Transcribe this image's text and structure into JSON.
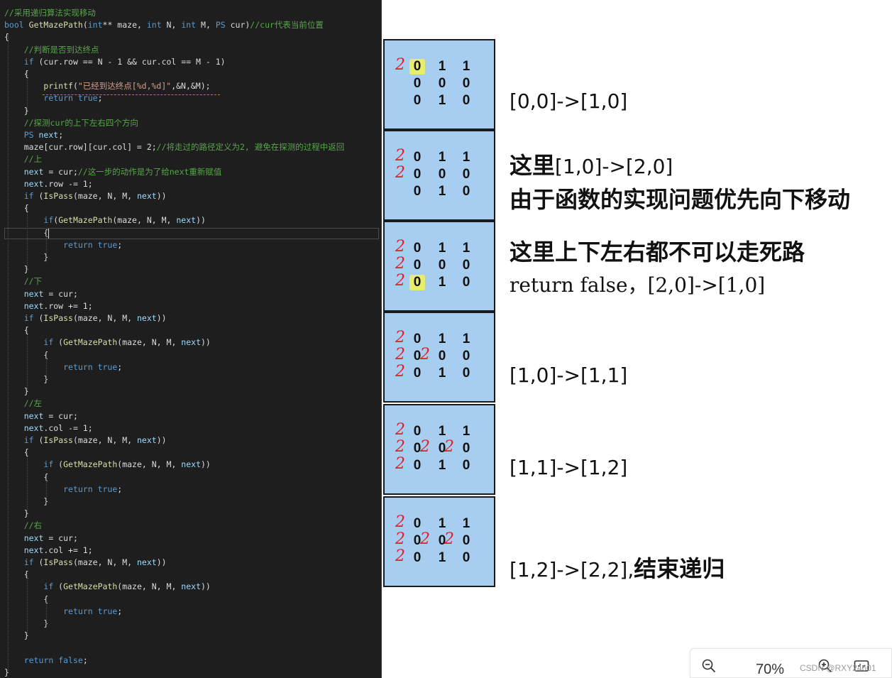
{
  "code": {
    "lines": [
      "//采用递归算法实现移动",
      "bool GetMazePath(int** maze, int N, int M, PS cur)//cur代表当前位置",
      "{",
      "    //判断是否到达终点",
      "    if (cur.row == N - 1 && cur.col == M - 1)",
      "    {",
      "        printf(\"已经到达终点[%d,%d]\",&N,&M);",
      "        return true;",
      "    }",
      "    //探测cur的上下左右四个方向",
      "    PS next;",
      "    maze[cur.row][cur.col] = 2;//将走过的路径定义为2, 避免在探测的过程中返回",
      "    //上",
      "    next = cur;//这一步的动作是为了给next重新赋值",
      "    next.row -= 1;",
      "    if (IsPass(maze, N, M, next))",
      "    {",
      "        if(GetMazePath(maze, N, M, next))",
      "        {",
      "            return true;",
      "        }",
      "    }",
      "    //下",
      "    next = cur;",
      "    next.row += 1;",
      "    if (IsPass(maze, N, M, next))",
      "    {",
      "        if (GetMazePath(maze, N, M, next))",
      "        {",
      "            return true;",
      "        }",
      "    }",
      "    //左",
      "    next = cur;",
      "    next.col -= 1;",
      "    if (IsPass(maze, N, M, next))",
      "    {",
      "        if (GetMazePath(maze, N, M, next))",
      "        {",
      "            return true;",
      "        }",
      "    }",
      "    //右",
      "    next = cur;",
      "    next.col += 1;",
      "    if (IsPass(maze, N, M, next))",
      "    {",
      "        if (GetMazePath(maze, N, M, next))",
      "        {",
      "            return true;",
      "        }",
      "    }",
      "",
      "    return false;",
      "}"
    ]
  },
  "mazes": [
    {
      "grid": [
        [
          "0",
          "1",
          "1"
        ],
        [
          "0",
          "0",
          "0"
        ],
        [
          "0",
          "1",
          "0"
        ]
      ],
      "marks": [
        [
          "2",
          "",
          ""
        ],
        [
          "",
          "",
          ""
        ],
        [
          "",
          "",
          ""
        ]
      ],
      "highlight": [
        [
          0,
          0
        ]
      ]
    },
    {
      "grid": [
        [
          "0",
          "1",
          "1"
        ],
        [
          "0",
          "0",
          "0"
        ],
        [
          "0",
          "1",
          "0"
        ]
      ],
      "marks": [
        [
          "2",
          "",
          ""
        ],
        [
          "2",
          "",
          ""
        ],
        [
          "",
          "",
          ""
        ]
      ],
      "highlight": []
    },
    {
      "grid": [
        [
          "0",
          "1",
          "1"
        ],
        [
          "0",
          "0",
          "0"
        ],
        [
          "0",
          "1",
          "0"
        ]
      ],
      "marks": [
        [
          "2",
          "",
          ""
        ],
        [
          "2",
          "",
          ""
        ],
        [
          "2",
          "",
          ""
        ]
      ],
      "highlight": [
        [
          2,
          0
        ]
      ]
    },
    {
      "grid": [
        [
          "0",
          "1",
          "1"
        ],
        [
          "0",
          "0",
          "0"
        ],
        [
          "0",
          "1",
          "0"
        ]
      ],
      "marks": [
        [
          "2",
          "",
          ""
        ],
        [
          "2",
          "2",
          ""
        ],
        [
          "2",
          "",
          ""
        ]
      ],
      "highlight": []
    },
    {
      "grid": [
        [
          "0",
          "1",
          "1"
        ],
        [
          "0",
          "0",
          "0"
        ],
        [
          "0",
          "1",
          "0"
        ]
      ],
      "marks": [
        [
          "2",
          "",
          ""
        ],
        [
          "2",
          "2",
          "2"
        ],
        [
          "2",
          "",
          ""
        ]
      ],
      "highlight": []
    },
    {
      "grid": [
        [
          "0",
          "1",
          "1"
        ],
        [
          "0",
          "0",
          "0"
        ],
        [
          "0",
          "1",
          "0"
        ]
      ],
      "marks": [
        [
          "2",
          "",
          ""
        ],
        [
          "2",
          "2",
          "2"
        ],
        [
          "2",
          "",
          ""
        ]
      ],
      "highlight": []
    }
  ],
  "notes": {
    "n1": "[0,0]->[1,0]",
    "n2_bold": "这里",
    "n2_rest": "[1,0]->[2,0]",
    "n2_line2": "由于函数的实现问题优先向下移动",
    "n3_line1": "这里上下左右都不可以走死路",
    "n3_line2": "return false，[2,0]->[1,0]",
    "n4": "[1,0]->[1,1]",
    "n5": "[1,1]->[1,2]",
    "n6_rest": "[1,2]->[2,2],",
    "n6_bold": "结束递归"
  },
  "zoom": {
    "percent": "70%",
    "watermark": "CSDN @RXY24601"
  },
  "colors": {
    "editor_bg": "#1e1e1e",
    "maze_bg": "#a7cdf0",
    "mark_red": "#e0202a",
    "highlight": "#e8ee6a",
    "comment": "#57a64a",
    "keyword": "#569cd6"
  }
}
